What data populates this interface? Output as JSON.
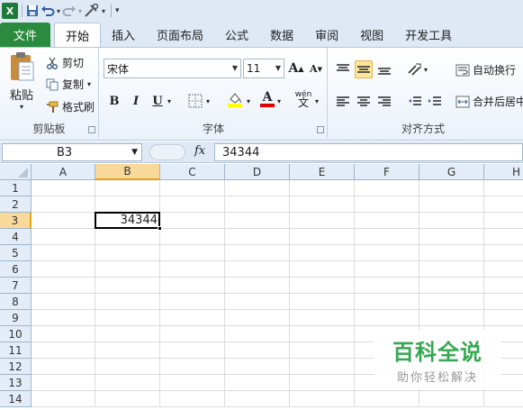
{
  "quick_access": {
    "app_icon": "excel-icon",
    "items": [
      "save-icon",
      "undo-icon",
      "redo-icon",
      "tools-icon",
      "customize-icon"
    ]
  },
  "tabs": {
    "file": "文件",
    "items": [
      "开始",
      "插入",
      "页面布局",
      "公式",
      "数据",
      "审阅",
      "视图",
      "开发工具"
    ],
    "active": "开始"
  },
  "ribbon": {
    "clipboard": {
      "paste": "粘贴",
      "cut": "剪切",
      "copy": "复制",
      "format_painter": "格式刷",
      "group_label": "剪贴板"
    },
    "font": {
      "font_name": "宋体",
      "font_size": "11",
      "bold": "B",
      "italic": "I",
      "underline": "U",
      "font_color_glyph": "A",
      "phonetic": "wén",
      "group_label": "字体"
    },
    "alignment": {
      "wrap_text": "自动换行",
      "merge_center": "合并后居中",
      "group_label": "对齐方式"
    }
  },
  "formula_bar": {
    "name_box": "B3",
    "fx": "fx",
    "formula": "34344"
  },
  "grid": {
    "columns": [
      "A",
      "B",
      "C",
      "D",
      "E",
      "F",
      "G",
      "H"
    ],
    "rows": [
      "1",
      "2",
      "3",
      "4",
      "5",
      "6",
      "7",
      "8",
      "9",
      "10",
      "11",
      "12",
      "13",
      "14"
    ],
    "selected_column": "B",
    "selected_row": "3",
    "cells": {
      "B3": "34344"
    }
  },
  "watermark": {
    "title": "百科全说",
    "subtitle": "助你轻松解决"
  },
  "colors": {
    "file_tab": "#2a8a3e",
    "selection_header": "#f9d99a",
    "watermark_green": "#36a852"
  }
}
